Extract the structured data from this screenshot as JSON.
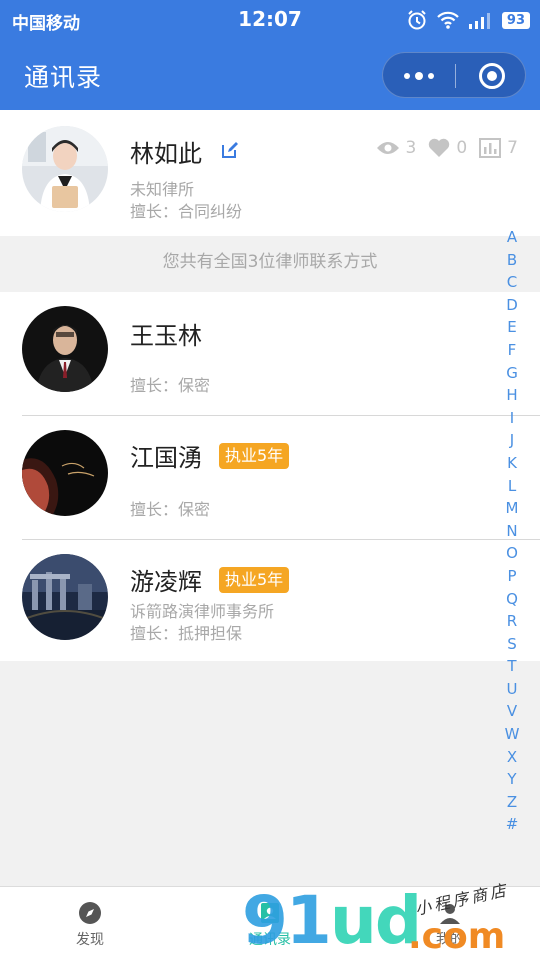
{
  "status_bar": {
    "carrier": "中国移动",
    "time": "12:07",
    "battery": "93"
  },
  "nav": {
    "title": "通讯录"
  },
  "profile": {
    "name": "林如此",
    "firm": "未知律所",
    "specialty": "擅长：合同纠纷",
    "views": "3",
    "likes": "0",
    "stats": "7"
  },
  "banner": "您共有全国3位律师联系方式",
  "lawyers": [
    {
      "name": "王玉林",
      "badge": "",
      "firm": "",
      "specialty": "擅长：保密"
    },
    {
      "name": "江国湧",
      "badge": "执业5年",
      "firm": "",
      "specialty": "擅长：保密"
    },
    {
      "name": "游凌辉",
      "badge": "执业5年",
      "firm": "诉箭路演律师事务所",
      "specialty": "擅长：抵押担保"
    }
  ],
  "alphabet": [
    "A",
    "B",
    "C",
    "D",
    "E",
    "F",
    "G",
    "H",
    "I",
    "J",
    "K",
    "L",
    "M",
    "N",
    "O",
    "P",
    "Q",
    "R",
    "S",
    "T",
    "U",
    "V",
    "W",
    "X",
    "Y",
    "Z",
    "#"
  ],
  "tabs": [
    {
      "label": "发现",
      "icon": "compass-icon"
    },
    {
      "label": "通讯录",
      "icon": "contacts-icon"
    },
    {
      "label": "我的",
      "icon": "user-icon"
    }
  ],
  "watermark": {
    "brand_digits": "91",
    "brand_letters": "ud",
    "domain": ".com",
    "tagline": "小程序商店"
  },
  "colors": {
    "primary": "#3a7be0",
    "badge": "#f5a623",
    "index": "#4a90e2",
    "tab_active": "#27c0a6"
  }
}
